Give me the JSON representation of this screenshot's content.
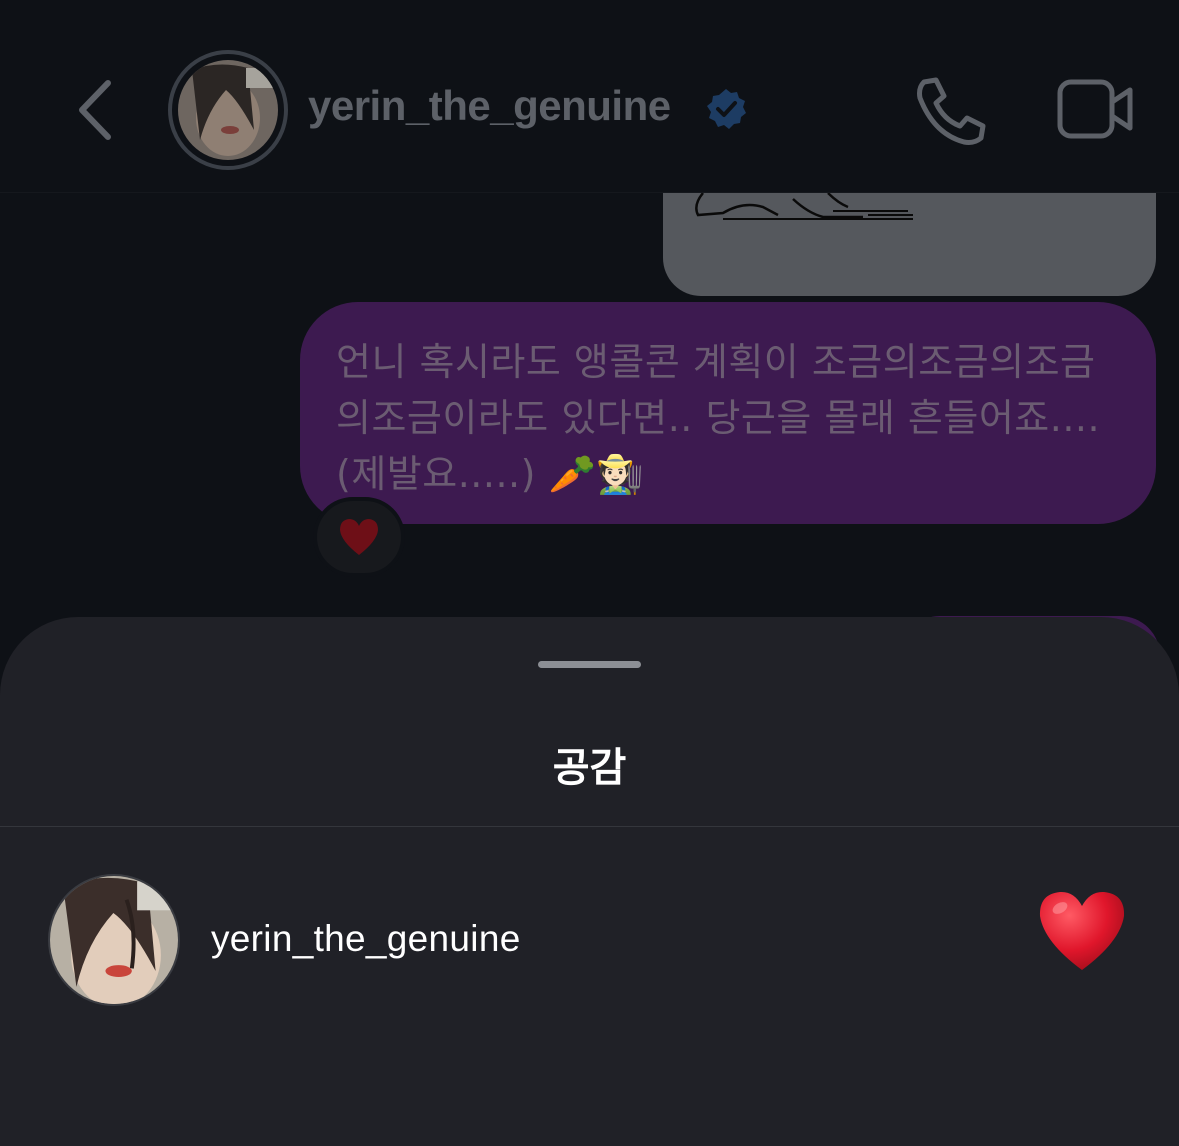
{
  "header": {
    "username": "yerin_the_genuine",
    "verified": true,
    "avatar_icon": "profile-photo"
  },
  "conversation": {
    "outgoing_text": "언니 혹시라도 앵콜콘 계획이 조금의조금의조금의조금이라도 있다면.. 당근을 몰래 흔들어죠....(제발요.....) 🥕🧑🏻‍🌾",
    "text_lines": [
      "언니 혹시라도 앵콜콘 계획이 조금의조금의조금",
      "의조금이라도 있다면.. 당근을 몰래 흔들어죠....",
      "(제발요.....) 🥕🧑🏻‍🌾"
    ],
    "reaction_on_message": "heart-icon"
  },
  "sheet": {
    "title": "공감",
    "reactors": [
      {
        "username": "yerin_the_genuine",
        "reaction": "heart-icon"
      }
    ]
  },
  "colors": {
    "sent_bubble": "#3d1a50",
    "sheet_bg": "#202127",
    "verified_blue": "#3897f0",
    "heart_red": "#e0162b"
  }
}
